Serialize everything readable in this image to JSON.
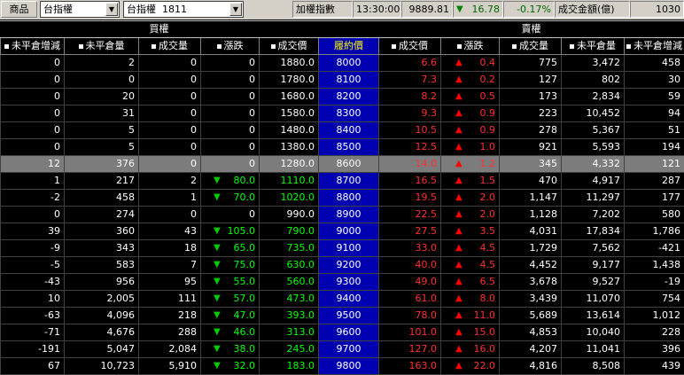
{
  "topbar": {
    "product_label": "商品",
    "product_combo": "台指權",
    "contract_combo": "台指權  1811",
    "index_label": "加權指數",
    "time": "13:30:00",
    "index_value": "9889.81",
    "index_change": "16.78",
    "index_pct": "-0.17%",
    "turnover_label": "成交金額(億)",
    "turnover_value": "1030"
  },
  "grid": {
    "call_group": "買權",
    "put_group": "賣權",
    "call_headers": [
      "未平倉增減",
      "未平倉量",
      "成交量",
      "漲跌",
      "成交價"
    ],
    "strike_header": "履約價",
    "put_headers": [
      "成交價",
      "漲跌",
      "成交量",
      "未平倉量",
      "未平倉增減"
    ]
  },
  "rows": [
    {
      "c_oi_chg": "0",
      "c_oi": "2",
      "c_vol": "0",
      "c_chg": "0",
      "c_price": "1880.0",
      "strike": "8000",
      "p_price": "6.6",
      "p_chg": "0.4",
      "p_vol": "775",
      "p_oi": "3,472",
      "p_oi_chg": "458",
      "c_dir": "",
      "p_dir": "up"
    },
    {
      "c_oi_chg": "0",
      "c_oi": "0",
      "c_vol": "0",
      "c_chg": "0",
      "c_price": "1780.0",
      "strike": "8100",
      "p_price": "7.3",
      "p_chg": "0.2",
      "p_vol": "127",
      "p_oi": "802",
      "p_oi_chg": "30",
      "c_dir": "",
      "p_dir": "up"
    },
    {
      "c_oi_chg": "0",
      "c_oi": "20",
      "c_vol": "0",
      "c_chg": "0",
      "c_price": "1680.0",
      "strike": "8200",
      "p_price": "8.2",
      "p_chg": "0.5",
      "p_vol": "173",
      "p_oi": "2,834",
      "p_oi_chg": "59",
      "c_dir": "",
      "p_dir": "up"
    },
    {
      "c_oi_chg": "0",
      "c_oi": "31",
      "c_vol": "0",
      "c_chg": "0",
      "c_price": "1580.0",
      "strike": "8300",
      "p_price": "9.3",
      "p_chg": "0.9",
      "p_vol": "223",
      "p_oi": "10,452",
      "p_oi_chg": "94",
      "c_dir": "",
      "p_dir": "up"
    },
    {
      "c_oi_chg": "0",
      "c_oi": "5",
      "c_vol": "0",
      "c_chg": "0",
      "c_price": "1480.0",
      "strike": "8400",
      "p_price": "10.5",
      "p_chg": "0.9",
      "p_vol": "278",
      "p_oi": "5,367",
      "p_oi_chg": "51",
      "c_dir": "",
      "p_dir": "up"
    },
    {
      "c_oi_chg": "0",
      "c_oi": "5",
      "c_vol": "0",
      "c_chg": "0",
      "c_price": "1380.0",
      "strike": "8500",
      "p_price": "12.5",
      "p_chg": "1.0",
      "p_vol": "921",
      "p_oi": "5,593",
      "p_oi_chg": "194",
      "c_dir": "",
      "p_dir": "up"
    },
    {
      "c_oi_chg": "12",
      "c_oi": "376",
      "c_vol": "0",
      "c_chg": "0",
      "c_price": "1280.0",
      "strike": "8600",
      "p_price": "14.0",
      "p_chg": "1.2",
      "p_vol": "345",
      "p_oi": "4,332",
      "p_oi_chg": "121",
      "c_dir": "",
      "p_dir": "up",
      "hl": true
    },
    {
      "c_oi_chg": "1",
      "c_oi": "217",
      "c_vol": "2",
      "c_chg": "80.0",
      "c_price": "1110.0",
      "strike": "8700",
      "p_price": "16.5",
      "p_chg": "1.5",
      "p_vol": "470",
      "p_oi": "4,917",
      "p_oi_chg": "287",
      "c_dir": "dn",
      "p_dir": "up"
    },
    {
      "c_oi_chg": "-2",
      "c_oi": "458",
      "c_vol": "1",
      "c_chg": "70.0",
      "c_price": "1020.0",
      "strike": "8800",
      "p_price": "19.5",
      "p_chg": "2.0",
      "p_vol": "1,147",
      "p_oi": "11,297",
      "p_oi_chg": "177",
      "c_dir": "dn",
      "p_dir": "up"
    },
    {
      "c_oi_chg": "0",
      "c_oi": "274",
      "c_vol": "0",
      "c_chg": "0",
      "c_price": "990.0",
      "strike": "8900",
      "p_price": "22.5",
      "p_chg": "2.0",
      "p_vol": "1,128",
      "p_oi": "7,202",
      "p_oi_chg": "580",
      "c_dir": "",
      "p_dir": "up"
    },
    {
      "c_oi_chg": "39",
      "c_oi": "360",
      "c_vol": "43",
      "c_chg": "105.0",
      "c_price": "790.0",
      "strike": "9000",
      "p_price": "27.5",
      "p_chg": "3.5",
      "p_vol": "4,031",
      "p_oi": "17,834",
      "p_oi_chg": "1,786",
      "c_dir": "dn",
      "p_dir": "up"
    },
    {
      "c_oi_chg": "-9",
      "c_oi": "343",
      "c_vol": "18",
      "c_chg": "65.0",
      "c_price": "735.0",
      "strike": "9100",
      "p_price": "33.0",
      "p_chg": "4.5",
      "p_vol": "1,729",
      "p_oi": "7,562",
      "p_oi_chg": "-421",
      "c_dir": "dn",
      "p_dir": "up"
    },
    {
      "c_oi_chg": "-5",
      "c_oi": "583",
      "c_vol": "7",
      "c_chg": "75.0",
      "c_price": "630.0",
      "strike": "9200",
      "p_price": "40.0",
      "p_chg": "4.5",
      "p_vol": "4,452",
      "p_oi": "9,177",
      "p_oi_chg": "1,438",
      "c_dir": "dn",
      "p_dir": "up"
    },
    {
      "c_oi_chg": "-43",
      "c_oi": "956",
      "c_vol": "95",
      "c_chg": "55.0",
      "c_price": "560.0",
      "strike": "9300",
      "p_price": "49.0",
      "p_chg": "6.5",
      "p_vol": "3,678",
      "p_oi": "9,527",
      "p_oi_chg": "-19",
      "c_dir": "dn",
      "p_dir": "up"
    },
    {
      "c_oi_chg": "10",
      "c_oi": "2,005",
      "c_vol": "111",
      "c_chg": "57.0",
      "c_price": "473.0",
      "strike": "9400",
      "p_price": "61.0",
      "p_chg": "8.0",
      "p_vol": "3,439",
      "p_oi": "11,070",
      "p_oi_chg": "754",
      "c_dir": "dn",
      "p_dir": "up"
    },
    {
      "c_oi_chg": "-63",
      "c_oi": "4,096",
      "c_vol": "218",
      "c_chg": "47.0",
      "c_price": "393.0",
      "strike": "9500",
      "p_price": "78.0",
      "p_chg": "11.0",
      "p_vol": "5,689",
      "p_oi": "13,614",
      "p_oi_chg": "1,012",
      "c_dir": "dn",
      "p_dir": "up"
    },
    {
      "c_oi_chg": "-71",
      "c_oi": "4,676",
      "c_vol": "288",
      "c_chg": "46.0",
      "c_price": "313.0",
      "strike": "9600",
      "p_price": "101.0",
      "p_chg": "15.0",
      "p_vol": "4,853",
      "p_oi": "10,040",
      "p_oi_chg": "228",
      "c_dir": "dn",
      "p_dir": "up"
    },
    {
      "c_oi_chg": "-191",
      "c_oi": "5,047",
      "c_vol": "2,084",
      "c_chg": "38.0",
      "c_price": "245.0",
      "strike": "9700",
      "p_price": "127.0",
      "p_chg": "16.0",
      "p_vol": "4,207",
      "p_oi": "11,041",
      "p_oi_chg": "396",
      "c_dir": "dn",
      "p_dir": "up"
    },
    {
      "c_oi_chg": "67",
      "c_oi": "10,723",
      "c_vol": "5,910",
      "c_chg": "32.0",
      "c_price": "183.0",
      "strike": "9800",
      "p_price": "163.0",
      "p_chg": "22.0",
      "p_vol": "4,816",
      "p_oi": "8,508",
      "p_oi_chg": "439",
      "c_dir": "dn",
      "p_dir": "up"
    }
  ]
}
